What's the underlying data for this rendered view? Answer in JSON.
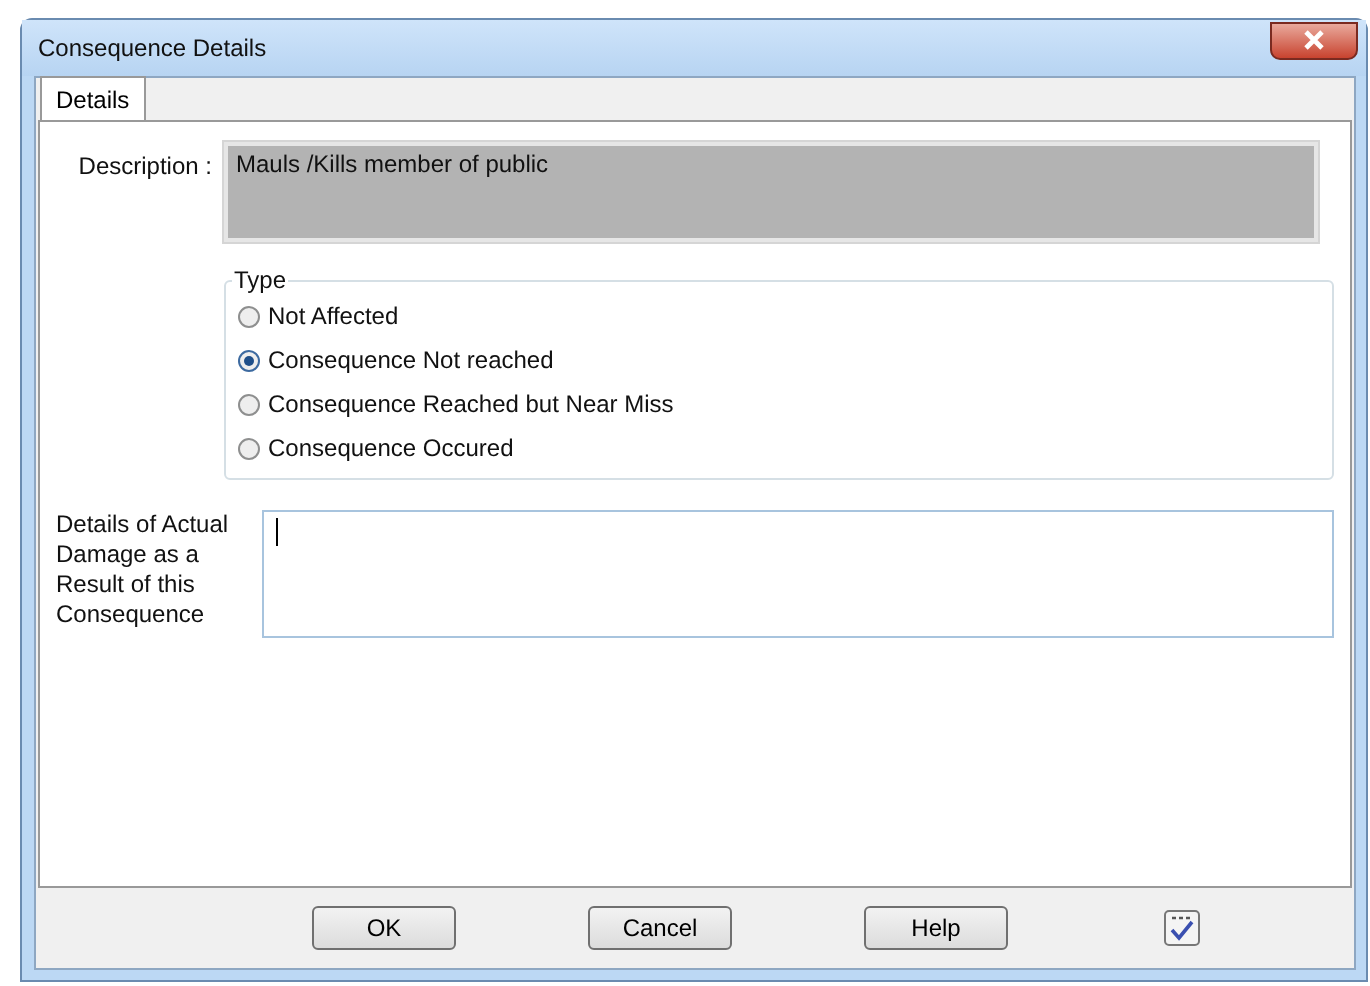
{
  "window": {
    "title": "Consequence Details"
  },
  "tabs": [
    {
      "label": "Details",
      "selected": true
    }
  ],
  "description": {
    "label": "Description :",
    "value": "Mauls /Kills member of public"
  },
  "type_group": {
    "legend": "Type",
    "options": [
      {
        "label": "Not Affected",
        "selected": false
      },
      {
        "label": "Consequence Not reached",
        "selected": true
      },
      {
        "label": "Consequence Reached but Near Miss",
        "selected": false
      },
      {
        "label": "Consequence Occured",
        "selected": false
      }
    ]
  },
  "details": {
    "label": "Details of Actual Damage as a Result of this Consequence"
  },
  "buttons": [
    "OK",
    "Cancel",
    "Help"
  ]
}
